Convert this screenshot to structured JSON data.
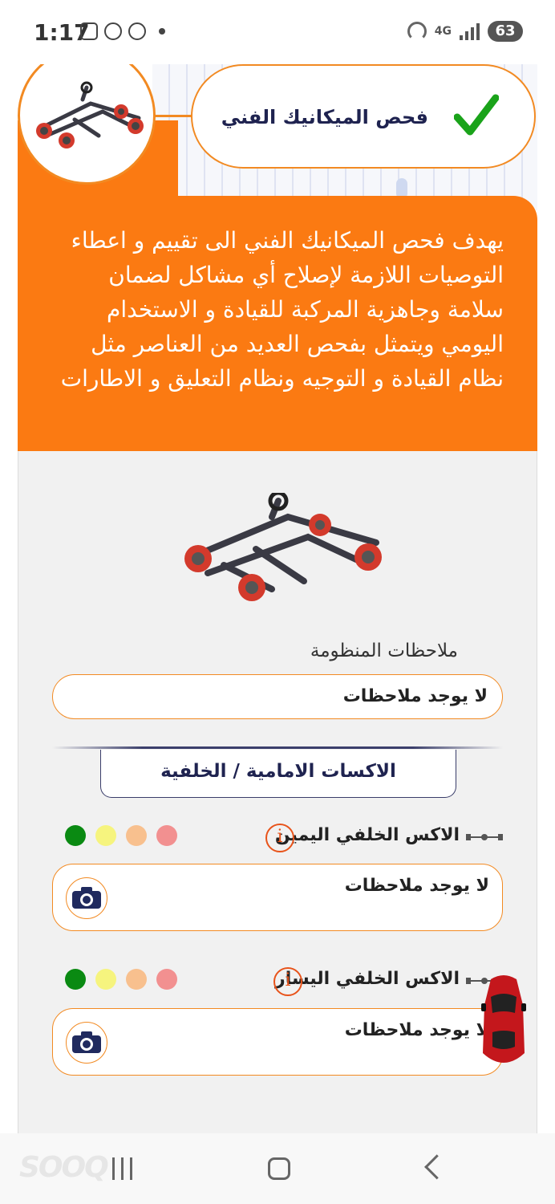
{
  "status_bar": {
    "time": "1:17",
    "network": "4G",
    "battery": "63"
  },
  "header": {
    "title": "فحص الميكانيك الفني",
    "check_icon": "green-checkmark"
  },
  "intro": {
    "description": "يهدف فحص الميكانيك الفني الى تقييم و اعطاء التوصيات اللازمة لإصلاح أي مشاكل لضمان سلامة وجاهزية المركبة للقيادة و الاستخدام اليومي ويتمثل بفحص العديد من العناصر مثل نظام القيادة و التوجيه ونظام التعليق و الاطارات"
  },
  "system_notes": {
    "label": "ملاحظات المنظومة",
    "value": "لا يوجد ملاحظات"
  },
  "section": {
    "title": "الاكسات الامامية / الخلفية"
  },
  "items": [
    {
      "label": "الاكس الخلفي اليمين",
      "note": "لا يوجد ملاحظات"
    },
    {
      "label": "الاكس الخلفي اليسار",
      "note": "لا يوجد ملاحظات"
    }
  ],
  "colors": {
    "accent": "#fb7a12",
    "navy": "#1f2350",
    "light_green": "#0a8a12",
    "light_yellow": "#f6f47e",
    "light_orange": "#f8c08e",
    "light_red": "#f29090"
  },
  "nav": {
    "watermark": "SOOQ"
  }
}
